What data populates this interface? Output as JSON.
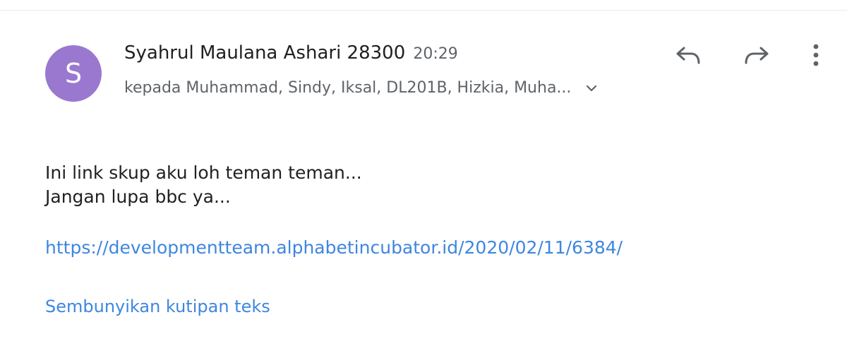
{
  "email": {
    "sender_initial": "S",
    "sender_name": "Syahrul Maulana Ashari 28300",
    "time": "20:29",
    "recipients": "kepada Muhammad, Sindy, Iksal, DL201B, Hizkia, Muha...",
    "body_line_1": "Ini link skup aku loh teman teman...",
    "body_line_2": "Jangan lupa bbc ya...",
    "link": "https://developmentteam.alphabetincubator.id/2020/02/11/6384/",
    "hide_quoted_text": "Sembunyikan kutipan teks"
  },
  "icons": {
    "reply": "reply-icon",
    "forward": "forward-icon",
    "more": "more-vert-icon",
    "expand": "chevron-down-icon"
  },
  "colors": {
    "avatar": "#9b78cf",
    "link": "#3f86df",
    "icon": "#5f6368"
  }
}
